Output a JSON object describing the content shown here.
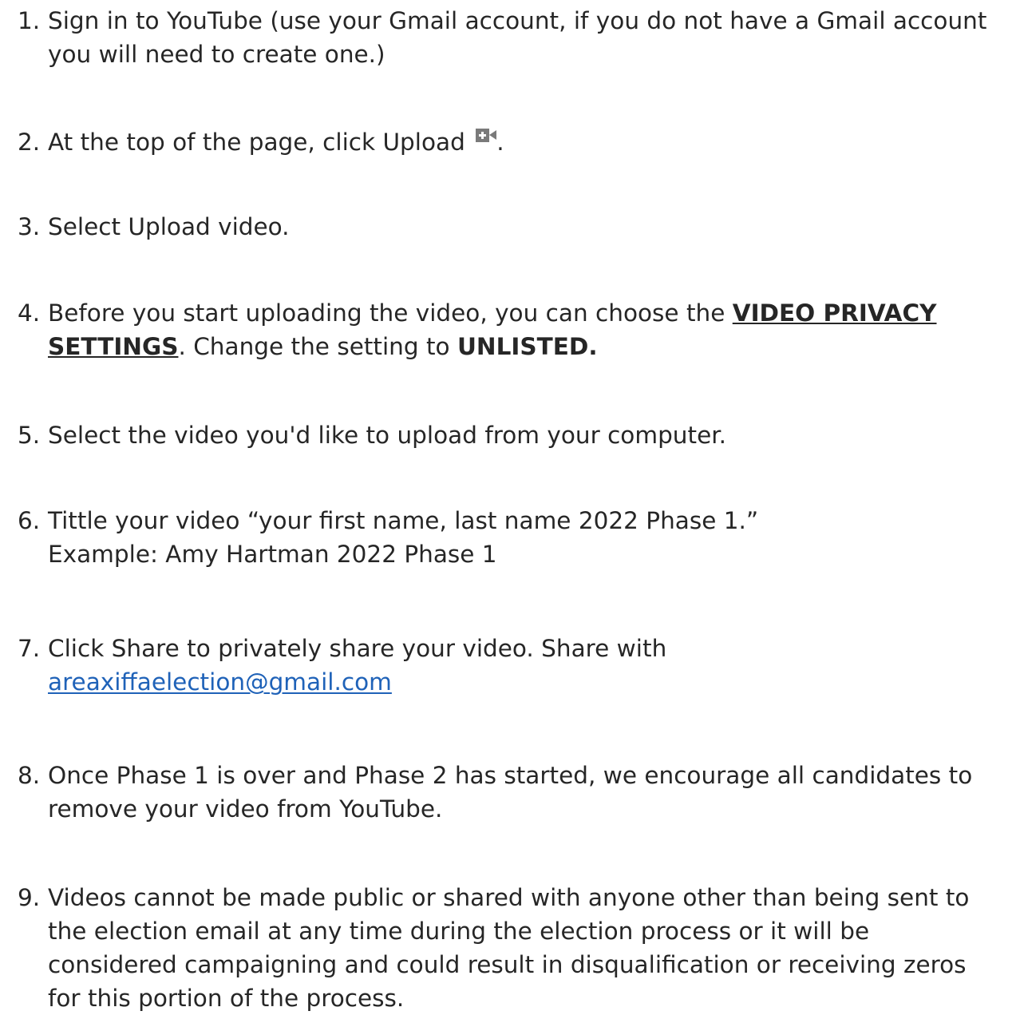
{
  "steps": [
    {
      "number": "1.",
      "line1": "Sign in to YouTube (use your Gmail account, if you do not have a Gmail account",
      "line2": "you will need to create one.)"
    },
    {
      "number": "2.",
      "text": "At the top of the page, click Upload",
      "icon": "upload-video-icon",
      "after_icon": "."
    },
    {
      "number": "3.",
      "text": "Select Upload video."
    },
    {
      "number": "4.",
      "before": "Before you start uploading the video, you can choose the ",
      "emphasis_1": "VIDEO PRIVACY",
      "emphasis_2": "SETTINGS",
      "middle": ". Change the setting to ",
      "emphasis_3": "UNLISTED."
    },
    {
      "number": "5.",
      "text": "Select the video you'd like to upload from your computer."
    },
    {
      "number": "6.",
      "line1": "Tittle your video “your first name, last name 2022 Phase 1.”",
      "line2": "Example: Amy Hartman 2022 Phase 1"
    },
    {
      "number": "7.",
      "line1": "Click Share to privately share your video. Share with",
      "email": "areaxiffaelection@gmail.com"
    },
    {
      "number": "8.",
      "line1": "Once Phase 1 is over and Phase 2 has started, we encourage all candidates to",
      "line2": "remove your video from YouTube."
    },
    {
      "number": "9.",
      "line1": "Videos cannot be made public or shared with anyone other than being sent to",
      "line2": "the election email at any time during the election process or it will be",
      "line3": "considered campaigning and could result in disqualification or receiving zeros",
      "line4": "for this portion of the process."
    }
  ]
}
